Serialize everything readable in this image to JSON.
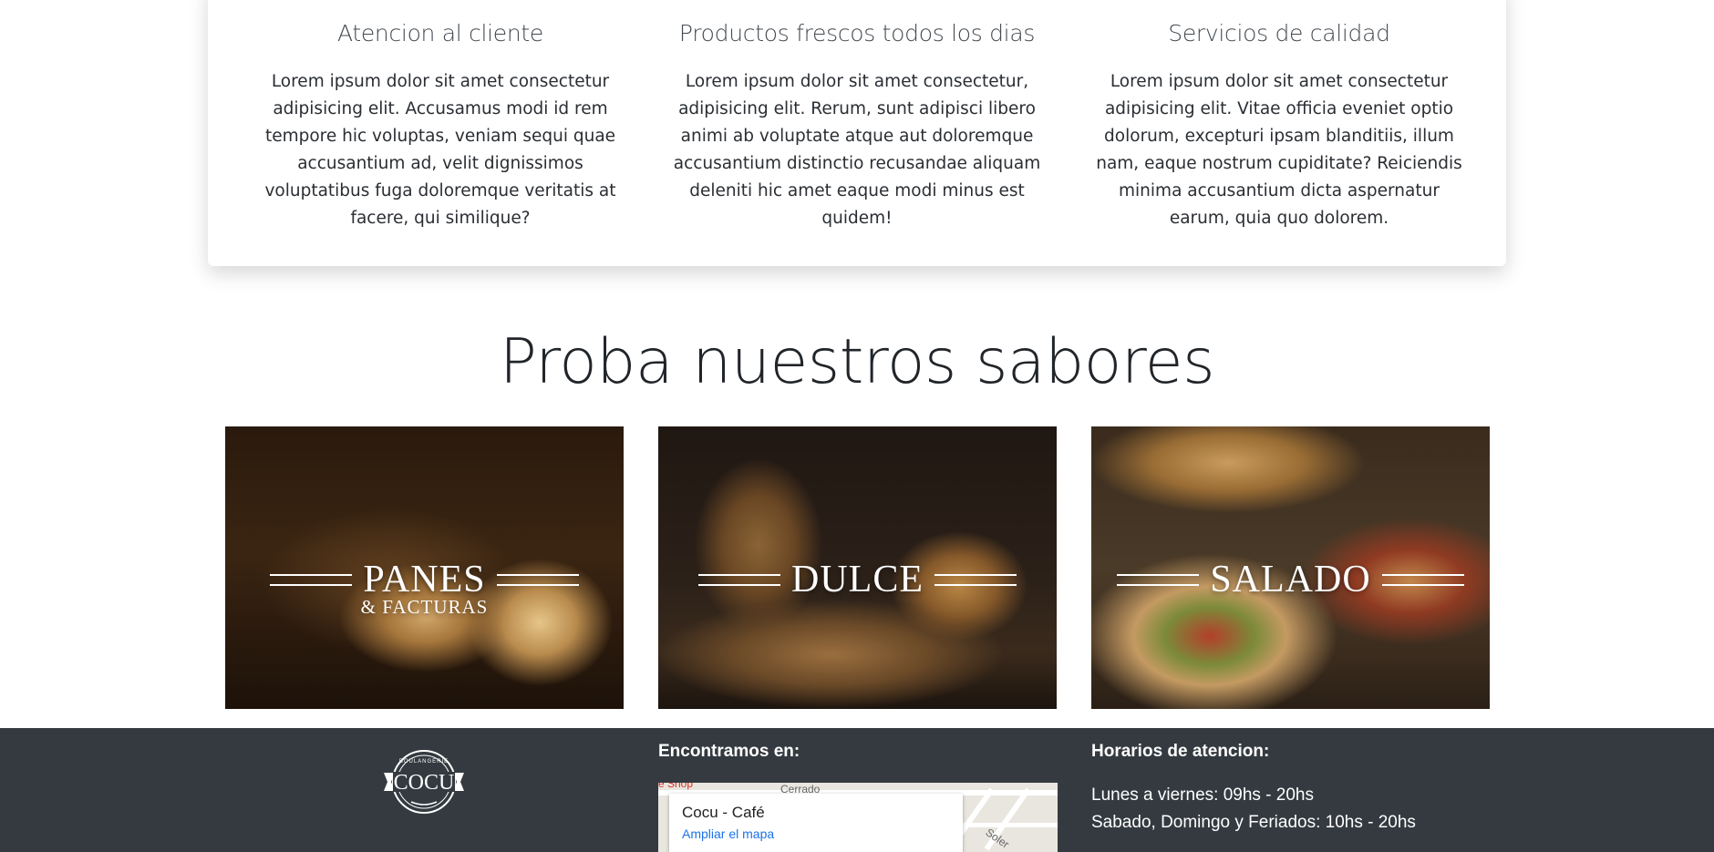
{
  "features": [
    {
      "title": "Atencion al cliente",
      "text": "Lorem ipsum dolor sit amet consectetur adipisicing elit. Accusamus modi id rem tempore hic voluptas, veniam sequi quae accusantium ad, velit dignissimos voluptatibus fuga doloremque veritatis at facere, qui similique?"
    },
    {
      "title": "Productos frescos todos los dias",
      "text": "Lorem ipsum dolor sit amet consectetur, adipisicing elit. Rerum, sunt adipisci libero animi ab voluptate atque aut doloremque accusantium distinctio recusandae aliquam deleniti hic amet eaque modi minus est quidem!"
    },
    {
      "title": "Servicios de calidad",
      "text": "Lorem ipsum dolor sit amet consectetur adipisicing elit. Vitae officia eveniet optio dolorum, excepturi ipsam blanditiis, illum nam, eaque nostrum cupiditate? Reiciendis minima accusantium dicta aspernatur earum, quia quo dolorem."
    }
  ],
  "flavors": {
    "title": "Proba nuestros sabores",
    "tiles": [
      {
        "label": "PANES",
        "sublabel": "& FACTURAS"
      },
      {
        "label": "DULCE"
      },
      {
        "label": "SALADO"
      }
    ]
  },
  "footer": {
    "logo_text": "COCU",
    "logo_ring_text": "BOULANGERIE",
    "location_heading": "Encontramos en:",
    "map": {
      "place_name": "Cocu - Café",
      "link_label": "Ampliar el mapa",
      "labels": [
        "e Shop",
        "Cerrado",
        "Soler"
      ]
    },
    "hours_heading": "Horarios de atencion:",
    "hours": [
      "Lunes a viernes: 09hs - 20hs",
      "Sabado, Domingo y Feriados: 10hs - 20hs"
    ]
  },
  "colors": {
    "footer_bg": "#343a40",
    "map_link": "#1a73e8",
    "card_bg": "#ffffff"
  }
}
